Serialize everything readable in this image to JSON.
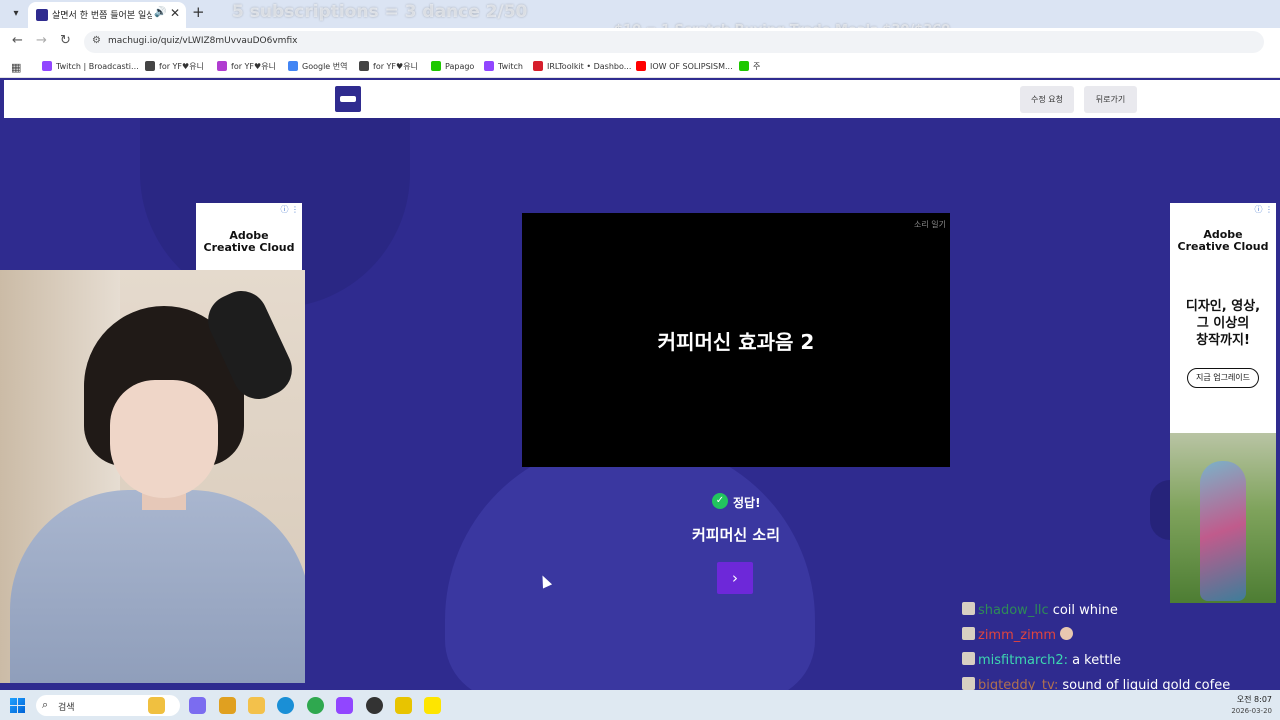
{
  "browser": {
    "tab_title": "살면서 한 번쯤 들어본 일상",
    "tab_audio_icon": "speaker-icon",
    "new_tab_label": "+",
    "url": "machugi.io/quiz/vLWIZ8mUvvauDO6vmfix",
    "bookmarks": [
      {
        "label": "Twitch | Broadcasti...",
        "color": "#9146ff"
      },
      {
        "label": "for YF♥유니",
        "color": "#444"
      },
      {
        "label": "for YF♥유니",
        "color": "#b03cd0"
      },
      {
        "label": "Google 번역",
        "color": "#4285f4"
      },
      {
        "label": "for YF♥유니",
        "color": "#444"
      },
      {
        "label": "Papago",
        "color": "#1ec800"
      },
      {
        "label": "Twitch",
        "color": "#9146ff"
      },
      {
        "label": "IRLToolkit • Dashbo...",
        "color": "#d61f2c"
      },
      {
        "label": "IOW OF SOLIPSISM...",
        "color": "#ff0000"
      },
      {
        "label": "주",
        "color": "#1ec800"
      }
    ]
  },
  "stream_overlay": {
    "top_text": "5 subscriptions = 3 dance 2/50",
    "price_text": "$10 = 1 Scratch Buying Trade Meals $30/$369"
  },
  "site_header": {
    "edit_request_label": "수정 요청",
    "back_label": "뒤로가기"
  },
  "quiz": {
    "video_corner_label": "소리 일기",
    "video_title": "커피머신 효과음 2",
    "correct_label": "정답!",
    "answer_text": "커피머신 소리",
    "next_icon": "chevron-right-icon"
  },
  "ads": {
    "left": {
      "brand": "Adobe\nCreative Cloud"
    },
    "right": {
      "brand": "Adobe\nCreative Cloud",
      "headline": "디자인, 영상,\n그 이상의\n창작까지!",
      "cta": "지금 업그레이드"
    }
  },
  "chat": [
    {
      "user": "shadow_llc",
      "message": "coil whine",
      "user_color": "#2e8b57"
    },
    {
      "user": "zimm_zimm",
      "message": "",
      "user_color": "#e0443e"
    },
    {
      "user": "misfitmarch2:",
      "message": "a kettle",
      "user_color": "#3dd6b0"
    },
    {
      "user": "bigteddy_tv:",
      "message": "sound of liquid gold cofee",
      "user_color": "#b07050"
    }
  ],
  "taskbar": {
    "search_placeholder": "검색",
    "time": "오전 8:07",
    "date": "2026-03-20",
    "apps": [
      {
        "name": "widget-icon",
        "color": "#f0c040"
      },
      {
        "name": "copilot-icon",
        "color": "#7b6cf0"
      },
      {
        "name": "search-app-icon",
        "color": "#e0a020"
      },
      {
        "name": "file-explorer-icon",
        "color": "#f3c14b"
      },
      {
        "name": "edge-icon",
        "color": "#1a8fd6"
      },
      {
        "name": "chrome-icon",
        "color": "#2fa84f"
      },
      {
        "name": "twitch-icon",
        "color": "#9146ff"
      },
      {
        "name": "obs-icon",
        "color": "#333333"
      },
      {
        "name": "streaming-app-icon",
        "color": "#e8c400"
      },
      {
        "name": "kakaotalk-icon",
        "color": "#fee500"
      }
    ]
  }
}
